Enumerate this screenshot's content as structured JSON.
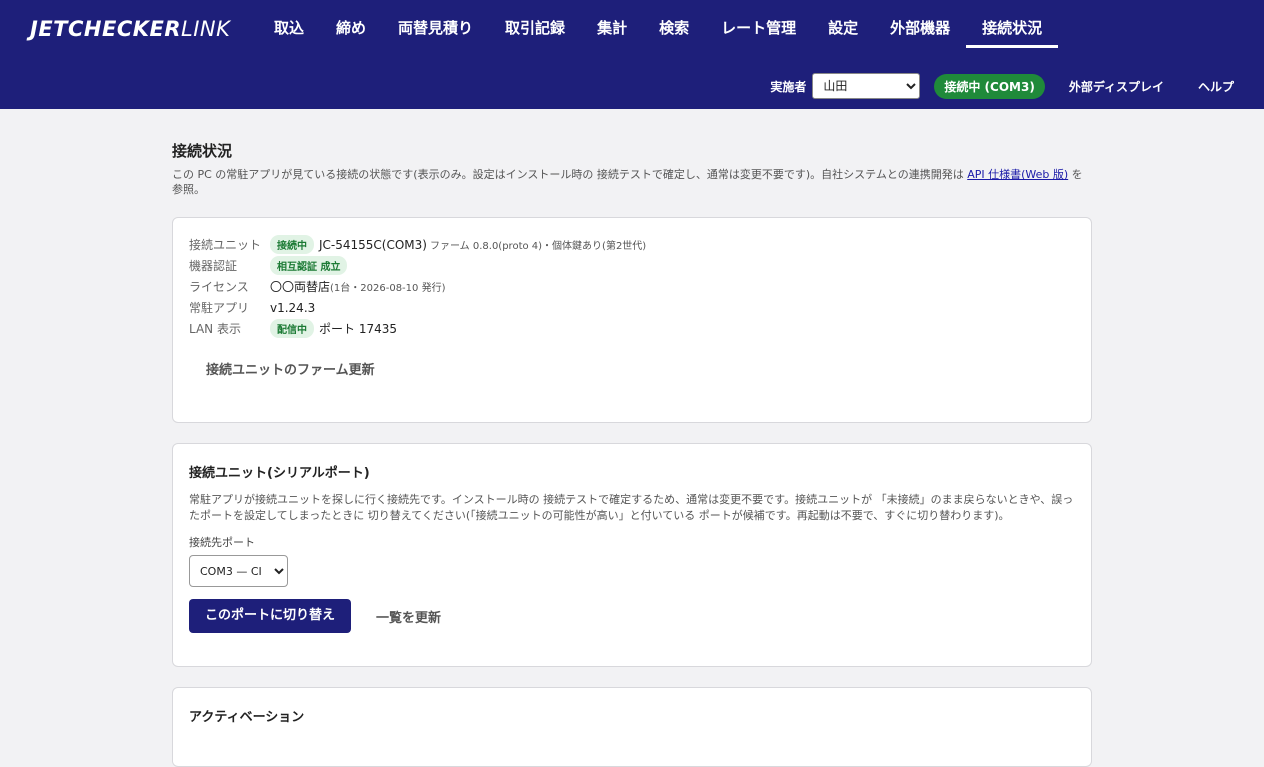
{
  "brand": {
    "logo_bold": "JETCHECKER",
    "logo_light": "LINK"
  },
  "nav": {
    "items": [
      "取込",
      "締め",
      "両替見積り",
      "取引記録",
      "集計",
      "検索",
      "レート管理",
      "設定",
      "外部機器",
      "接続状況"
    ],
    "active_index": 9
  },
  "subbar": {
    "operator_label": "実施者",
    "operator_value": "山田",
    "connection_status": "接続中 (COM3)",
    "external_display": "外部ディスプレイ",
    "help": "ヘルプ"
  },
  "page": {
    "title": "接続状況",
    "desc_before_link": "この PC の常駐アプリが見ている接続の状態です(表示のみ。設定はインストール時の 接続テストで確定し、通常は変更不要です)。自社システムとの連携開発は ",
    "desc_link": "API 仕様書(Web 版)",
    "desc_after_link": " を参照。"
  },
  "status_card": {
    "rows": [
      {
        "key": "接続ユニット",
        "badge": "接続中",
        "value": "JC-54155C(COM3)",
        "small": "ファーム 0.8.0(proto 4)・個体鍵あり(第2世代)"
      },
      {
        "key": "機器認証",
        "badge": "相互認証 成立",
        "value": "",
        "small": ""
      },
      {
        "key": "ライセンス",
        "badge": "",
        "value": "〇〇両替店",
        "small": "(1台・2026-08-10 発行)"
      },
      {
        "key": "常駐アプリ",
        "badge": "",
        "value": "v1.24.3",
        "small": ""
      },
      {
        "key": "LAN 表示",
        "badge": "配信中",
        "value": "ポート 17435",
        "small": ""
      }
    ],
    "firmware_button": "接続ユニットのファーム更新"
  },
  "serial_card": {
    "title": "接続ユニット(シリアルポート)",
    "desc": "常駐アプリが接続ユニットを探しに行く接続先です。インストール時の 接続テストで確定するため、通常は変更不要です。接続ユニットが 「未接続」のまま戻らないときや、誤ったポートを設定してしまったときに 切り替えてください(「接続ユニットの可能性が高い」と付いている ポートが候補です。再起動は不要で、すぐに切り替わります)。",
    "port_label": "接続先ポート",
    "port_value": "COM3 — CI",
    "switch_button": "このポートに切り替え",
    "refresh_button": "一覧を更新"
  },
  "activation_card": {
    "title": "アクティベーション"
  }
}
